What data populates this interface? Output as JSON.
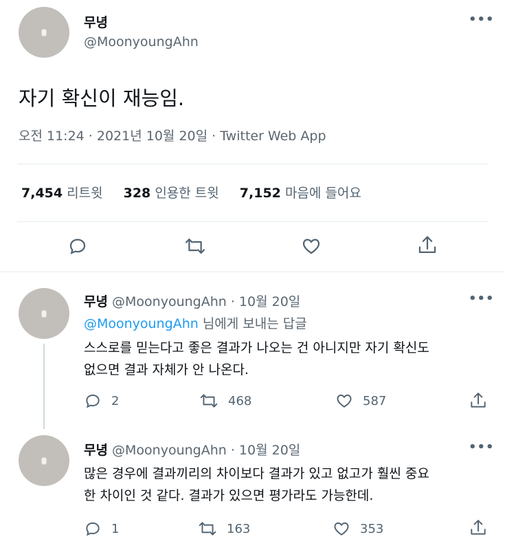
{
  "main_tweet": {
    "author_name": "무녕",
    "author_handle": "@MoonyoungAhn",
    "text": "자기 확신이 재능임.",
    "timestamp": "오전 11:24 · 2021년 10월 20일 · Twitter Web App",
    "stats": {
      "retweets_count": "7,454",
      "retweets_label": "리트윗",
      "quotes_count": "328",
      "quotes_label": "인용한 트윗",
      "likes_count": "7,152",
      "likes_label": "마음에 들어요"
    }
  },
  "replies": [
    {
      "author_name": "무녕",
      "header_meta": "@MoonyoungAhn · 10월 20일",
      "reply_to_handle": "@MoonyoungAhn",
      "reply_to_suffix": " 님에게 보내는 답글",
      "text_line1": "스스로를 믿는다고 좋은 결과가 나오는 건 아니지만 자기 확신도",
      "text_line2": "없으면 결과 자체가 안 나온다.",
      "reply_count": "2",
      "retweet_count": "468",
      "like_count": "587"
    },
    {
      "author_name": "무녕",
      "header_meta": "@MoonyoungAhn · 10월 20일",
      "text_line1": "많은 경우에 결과끼리의 차이보다 결과가 있고 없고가 훨씬 중요",
      "text_line2": "한 차이인 것 같다. 결과가 있으면 평가라도 가능한데.",
      "reply_count": "1",
      "retweet_count": "163",
      "like_count": "353"
    }
  ],
  "icons": {
    "more": "more-icon",
    "reply": "reply-icon",
    "retweet": "retweet-icon",
    "like": "heart-icon",
    "share": "share-icon"
  },
  "colors": {
    "text": "#0f1419",
    "muted": "#5b6670",
    "link": "#1d9bf0",
    "divider": "#e6ecf0"
  }
}
